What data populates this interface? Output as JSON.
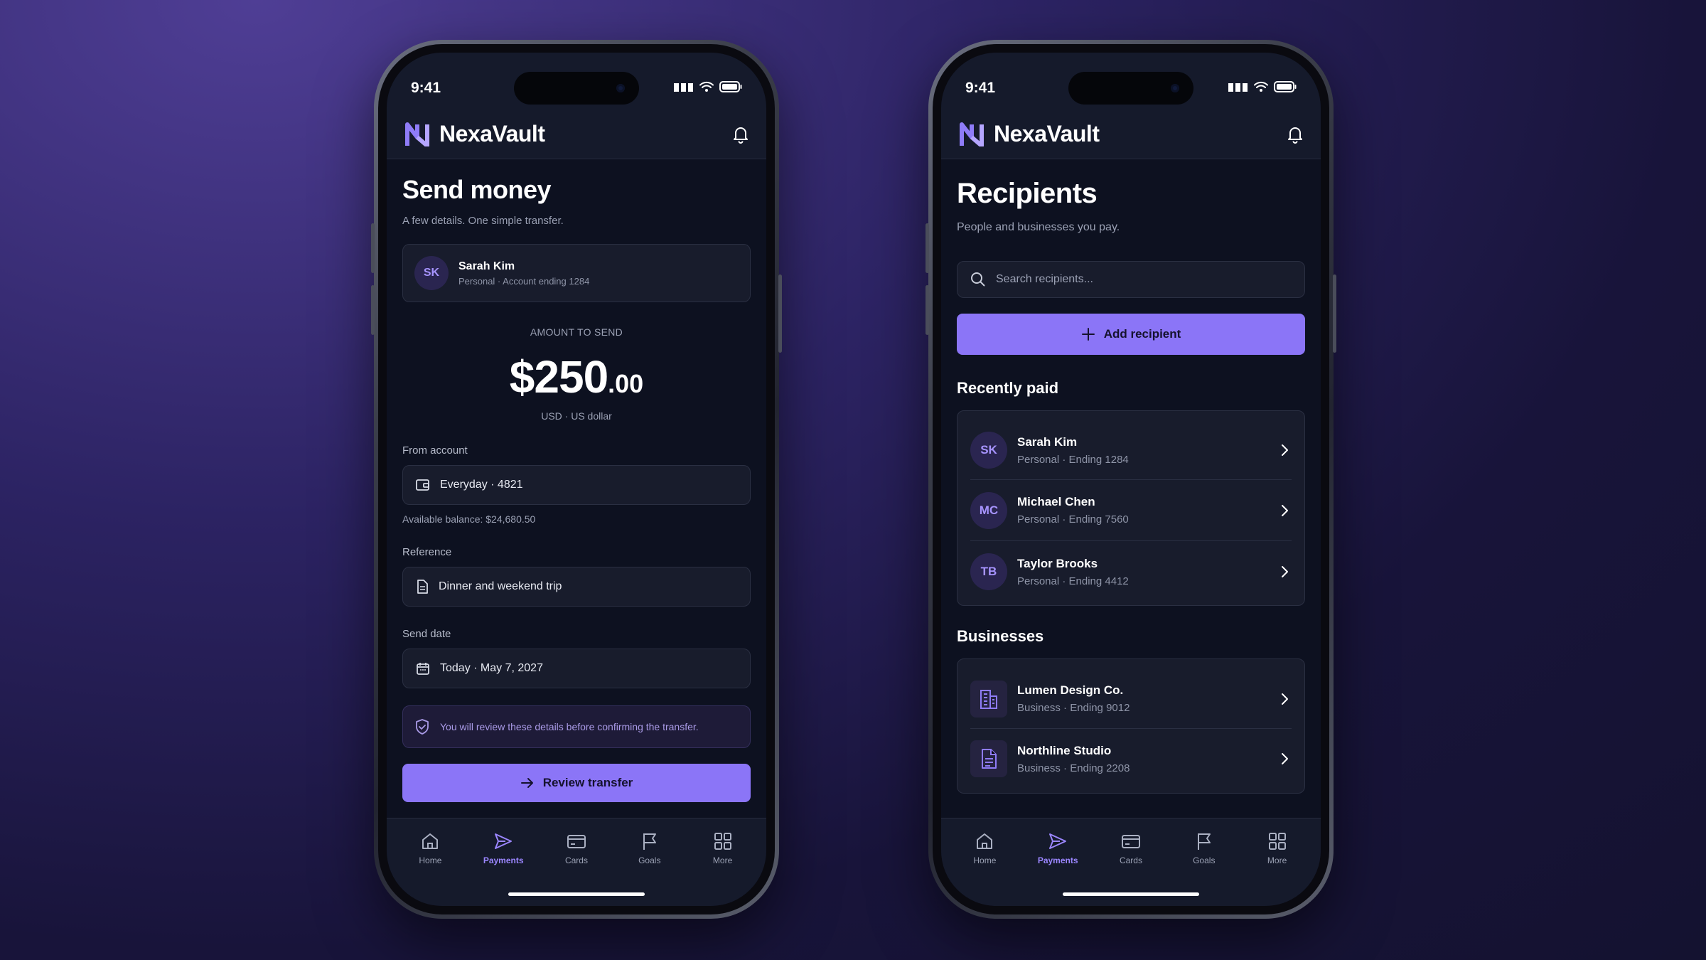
{
  "status": {
    "time": "9:41"
  },
  "brand": {
    "name": "NexaVault"
  },
  "send": {
    "title": "Send money",
    "subtitle": "A few details. One simple transfer.",
    "recipient": {
      "initials": "SK",
      "name": "Sarah Kim",
      "meta": "Personal · Account ending 1284"
    },
    "amount_label": "AMOUNT TO SEND",
    "amount_whole": "$250",
    "amount_cents": ".00",
    "currency": "USD · US dollar",
    "from_label": "From account",
    "from_value": "Everyday · 4821",
    "balance": "Available balance: $24,680.50",
    "reference_label": "Reference",
    "reference_value": "Dinner and weekend trip",
    "date_label": "Send date",
    "date_value": "Today · May 7, 2027",
    "notice": "You will review these details before confirming the transfer.",
    "review_button": "Review transfer"
  },
  "recipients": {
    "title": "Recipients",
    "subtitle": "People and businesses you pay.",
    "search_placeholder": "Search recipients...",
    "add_button": "Add recipient",
    "recent_title": "Recently paid",
    "recent": [
      {
        "initials": "SK",
        "name": "Sarah Kim",
        "meta": "Personal · Ending 1284"
      },
      {
        "initials": "MC",
        "name": "Michael Chen",
        "meta": "Personal · Ending 7560"
      },
      {
        "initials": "TB",
        "name": "Taylor Brooks",
        "meta": "Personal · Ending 4412"
      }
    ],
    "business_title": "Businesses",
    "businesses": [
      {
        "icon": "building-icon",
        "name": "Lumen Design Co.",
        "meta": "Business · Ending 9012"
      },
      {
        "icon": "document-icon",
        "name": "Northline Studio",
        "meta": "Business · Ending 2208"
      }
    ]
  },
  "tabs": [
    {
      "label": "Home",
      "icon": "home-icon"
    },
    {
      "label": "Payments",
      "icon": "send-icon",
      "active": true
    },
    {
      "label": "Cards",
      "icon": "card-icon"
    },
    {
      "label": "Goals",
      "icon": "flag-icon"
    },
    {
      "label": "More",
      "icon": "grid-icon"
    }
  ],
  "colors": {
    "accent": "#8b75f7",
    "background": "#0d1120",
    "card": "#181c2c"
  }
}
